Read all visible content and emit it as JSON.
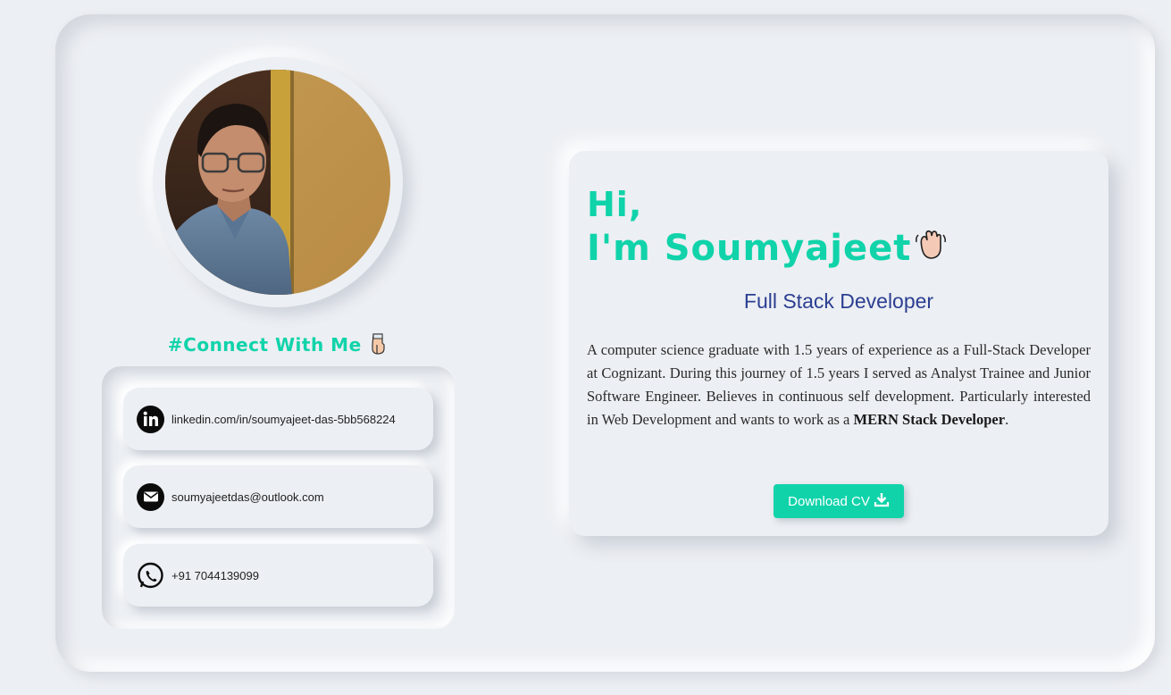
{
  "profile": {
    "photo_alt": "Profile photo"
  },
  "connect": {
    "title": "#Connect With Me"
  },
  "contacts": [
    {
      "label": "linkedin.com/in/soumyajeet-das-5bb568224",
      "icon": "linkedin-icon"
    },
    {
      "label": "soumyajeetdas@outlook.com",
      "icon": "mail-icon"
    },
    {
      "label": "+91 7044139099",
      "icon": "whatsapp-icon"
    }
  ],
  "hero": {
    "greeting": "Hi,",
    "name": "I'm Soumyajeet",
    "role": "Full Stack Developer",
    "bio_text": "A computer science graduate with 1.5 years of experience as a Full-Stack Developer at Cognizant. During this journey of 1.5 years I served as Analyst Trainee and Junior Software Engineer. Believes in continuous self development. Particularly interested in Web Development and wants to work as a ",
    "bio_emphasis": "MERN Stack Developer",
    "bio_end": ".",
    "download_label": "Download CV"
  },
  "colors": {
    "accent": "#10d3aa",
    "role": "#2c3e92",
    "background": "#eceff3"
  }
}
